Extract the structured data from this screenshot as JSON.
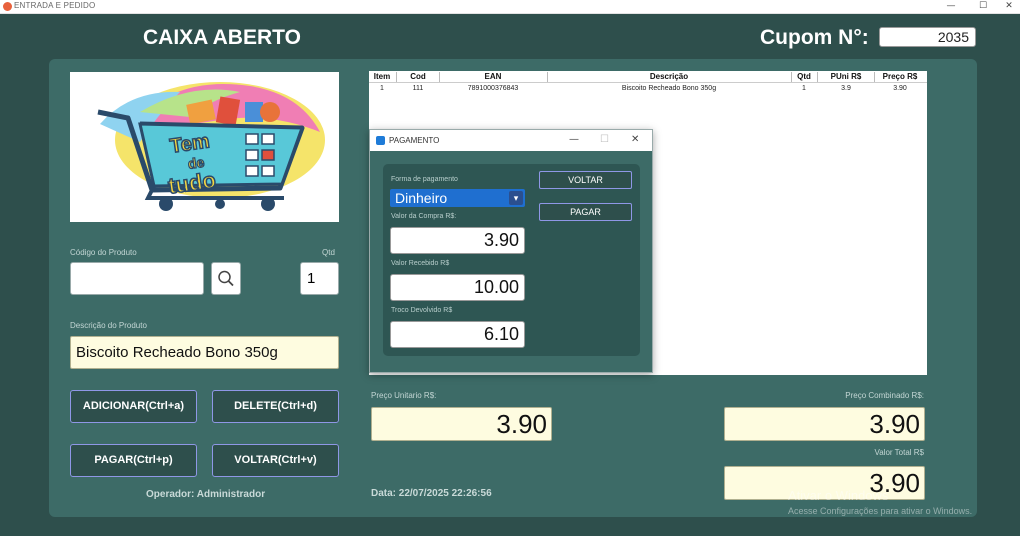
{
  "window": {
    "title": "ENTRADA E PEDIDO",
    "minimize": "—",
    "maximize": "☐",
    "close": "✕"
  },
  "header": {
    "title": "CAIXA ABERTO",
    "cupom_label": "Cupom N°:",
    "cupom_value": "2035"
  },
  "logo": {
    "line1": "Tem",
    "line2": "de",
    "line3": "tudo"
  },
  "product": {
    "code_label": "Código do Produto",
    "code_value": "",
    "qty_label": "Qtd",
    "qty_value": "1",
    "desc_label": "Descrição do Produto",
    "desc_value": "Biscoito Recheado Bono 350g"
  },
  "buttons": {
    "add": "ADICIONAR(Ctrl+a)",
    "delete": "DELETE(Ctrl+d)",
    "pay": "PAGAR(Ctrl+p)",
    "back": "VOLTAR(Ctrl+v)"
  },
  "operator": "Operador: Administrador",
  "date": "Data: 22/07/2025 22:26:56",
  "table": {
    "headers": [
      "Item",
      "Cod",
      "EAN",
      "Descrição",
      "Qtd",
      "PUni R$",
      "Preço R$"
    ],
    "rows": [
      [
        "1",
        "111",
        "7891000376843",
        "Biscoito Recheado Bono 350g",
        "1",
        "3.9",
        "3.90"
      ]
    ]
  },
  "totals": {
    "unit_label": "Preço Unitario R$:",
    "unit_value": "3.90",
    "combined_label": "Preço Combinado R$:",
    "combined_value": "3.90",
    "total_label": "Valor Total R$",
    "total_value": "3.90"
  },
  "dialog": {
    "title": "PAGAMENTO",
    "min": "—",
    "max": "☐",
    "close": "✕",
    "method_label": "Forma de pagamento",
    "method_value": "Dinheiro",
    "purchase_label": "Valor da Compra R$:",
    "purchase_value": "3.90",
    "received_label": "Valor Recebido R$",
    "received_value": "10.00",
    "change_label": "Troco Devolvido R$",
    "change_value": "6.10",
    "back_button": "VOLTAR",
    "pay_button": "PAGAR"
  },
  "watermark": {
    "line1": "Ativar o Windows",
    "line2": "Acesse Configurações para ativar o Windows."
  }
}
